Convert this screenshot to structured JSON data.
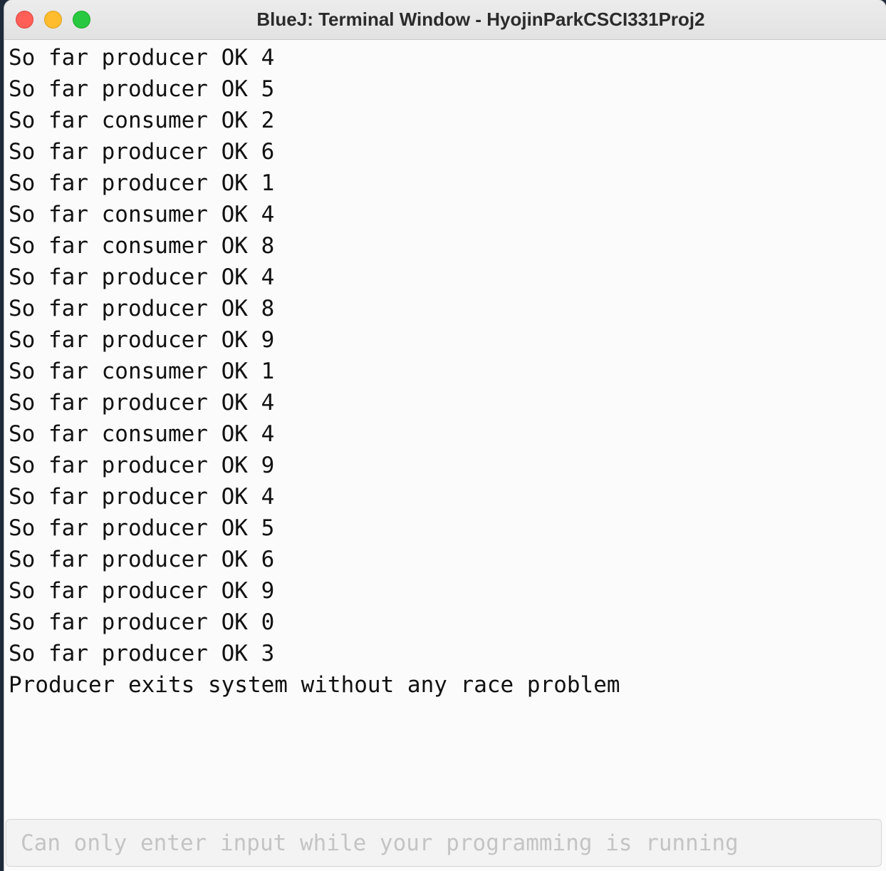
{
  "window": {
    "title": "BlueJ: Terminal Window - HyojinParkCSCI331Proj2"
  },
  "terminal": {
    "lines": [
      "So far producer OK 4",
      "So far producer OK 5",
      "So far consumer OK 2",
      "So far producer OK 6",
      "So far producer OK 1",
      "So far consumer OK 4",
      "So far consumer OK 8",
      "So far producer OK 4",
      "So far producer OK 8",
      "So far producer OK 9",
      "So far consumer OK 1",
      "So far producer OK 4",
      "So far consumer OK 4",
      "So far producer OK 9",
      "So far producer OK 4",
      "So far producer OK 5",
      "So far producer OK 6",
      "So far producer OK 9",
      "So far producer OK 0",
      "So far producer OK 3",
      "Producer exits system without any race problem"
    ]
  },
  "input": {
    "placeholder": "Can only enter input while your programming is running",
    "value": ""
  }
}
